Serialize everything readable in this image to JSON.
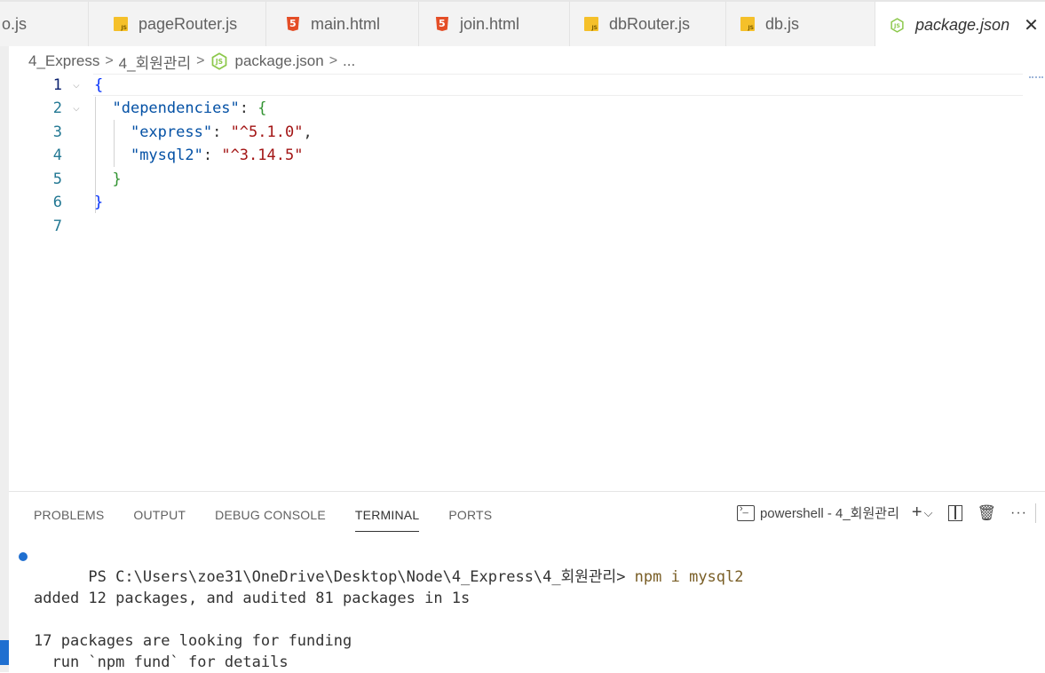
{
  "tabs": [
    {
      "label": "o.js",
      "icon": "js-file-icon",
      "left": 0
    },
    {
      "label": "pageRouter.js",
      "icon": "js-file-icon"
    },
    {
      "label": "main.html",
      "icon": "html5-file-icon"
    },
    {
      "label": "join.html",
      "icon": "html5-file-icon"
    },
    {
      "label": "dbRouter.js",
      "icon": "js-file-icon"
    },
    {
      "label": "db.js",
      "icon": "js-file-icon"
    },
    {
      "label": "package.json",
      "icon": "nodejs-icon",
      "close": "✕"
    }
  ],
  "breadcrumb": {
    "part1": "4_Express",
    "part2": "4_회원관리",
    "file": "package.json",
    "more": "...",
    "sep": ">"
  },
  "editor": {
    "line_numbers": [
      "1",
      "2",
      "3",
      "4",
      "5",
      "6",
      "7"
    ],
    "line1": "{",
    "line2_key": "\"dependencies\"",
    "line2_colon": ": ",
    "line2_brace": "{",
    "line3_key": "\"express\"",
    "line3_colon": ": ",
    "line3_val": "\"^5.1.0\"",
    "line3_comma": ",",
    "line4_key": "\"mysql2\"",
    "line4_colon": ": ",
    "line4_val": "\"^3.14.5\"",
    "line5": "}",
    "line6": "}"
  },
  "panel": {
    "tabs": [
      "PROBLEMS",
      "OUTPUT",
      "DEBUG CONSOLE",
      "TERMINAL",
      "PORTS"
    ],
    "active_tab": "TERMINAL",
    "shell_label": "powershell - 4_회원관리",
    "plus": "+",
    "chevron": "⌵",
    "trash": "🗑",
    "more": "···"
  },
  "terminal": {
    "prompt": "PS C:\\Users\\zoe31\\OneDrive\\Desktop\\Node\\4_Express\\4_회원관리> ",
    "command": "npm i mysql2",
    "line2": "added 12 packages, and audited 81 packages in 1s",
    "line3": "17 packages are looking for funding",
    "line4": "  run `npm fund` for details"
  },
  "colors": {
    "accent": "#1f6fd0",
    "key": "#0451a5",
    "string": "#a31515"
  }
}
